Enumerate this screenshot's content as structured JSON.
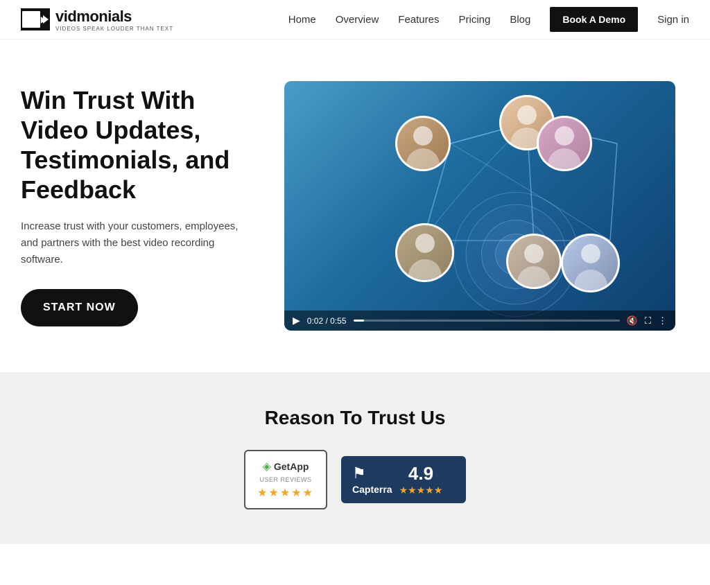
{
  "logo": {
    "name": "vidmonials",
    "tagline": "VIDEOS SPEAK LOUDER THAN TEXT"
  },
  "nav": {
    "home": "Home",
    "overview": "Overview",
    "features": "Features",
    "pricing": "Pricing",
    "blog": "Blog",
    "book_demo": "Book A Demo",
    "sign_in": "Sign in"
  },
  "hero": {
    "heading": "Win Trust With Video Updates, Testimonials, and Feedback",
    "subtext": "Increase trust with your customers, employees, and partners with the best video recording software.",
    "cta": "START NOW"
  },
  "video": {
    "current_time": "0:02",
    "total_time": "0:55",
    "progress_pct": 4
  },
  "trust": {
    "title": "Reason To Trust Us",
    "getapp": {
      "name": "GetApp",
      "sub": "USER REVIEWS",
      "stars": "★★★★★"
    },
    "capterra": {
      "name": "Capterra",
      "score": "4.9",
      "stars": "★★★★★"
    }
  }
}
